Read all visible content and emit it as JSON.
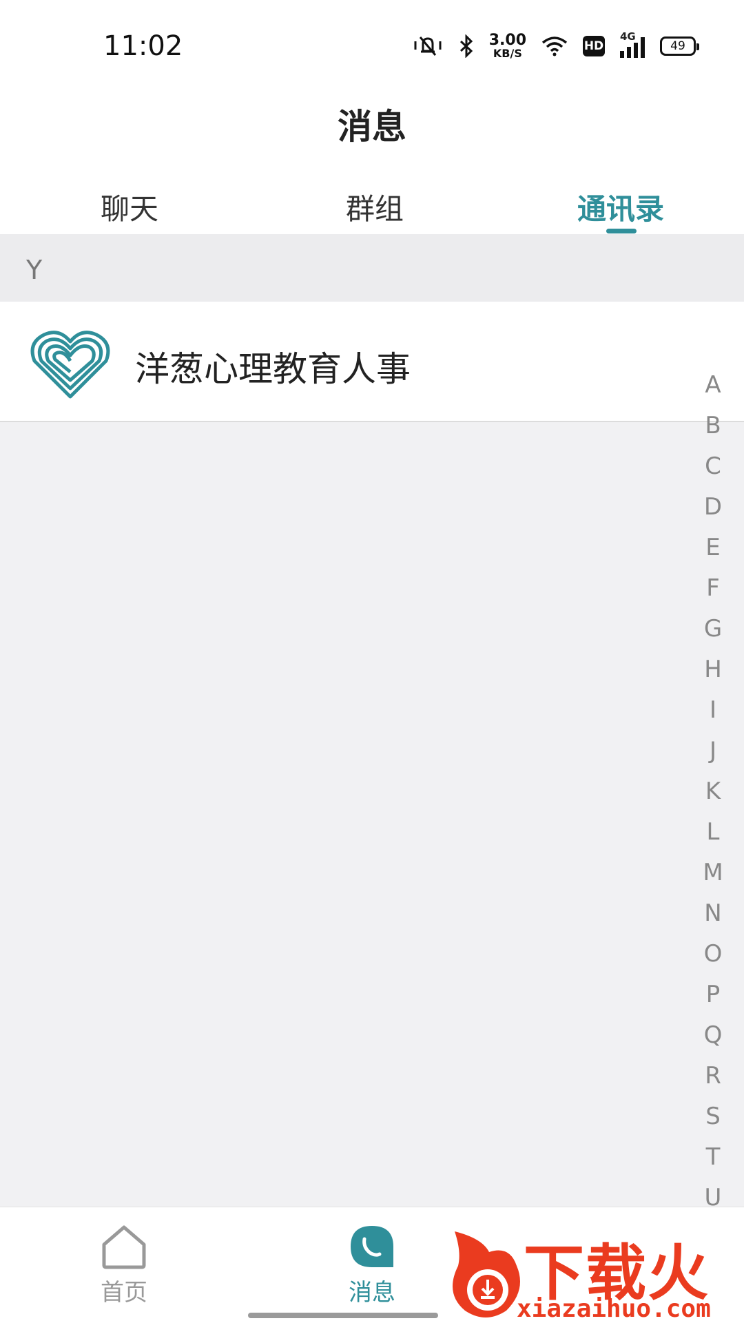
{
  "status_bar": {
    "time": "11:02",
    "net_speed": "3.00",
    "net_unit": "KB/S",
    "hd": "HD",
    "network": "4G",
    "battery": "49"
  },
  "header": {
    "title": "消息"
  },
  "tabs": [
    {
      "label": "聊天",
      "active": false
    },
    {
      "label": "群组",
      "active": false
    },
    {
      "label": "通讯录",
      "active": true
    }
  ],
  "contacts": {
    "section_letter": "Y",
    "items": [
      {
        "name": "洋葱心理教育人事",
        "avatar": "heart-logo-icon"
      }
    ]
  },
  "alphabet_index": [
    "A",
    "B",
    "C",
    "D",
    "E",
    "F",
    "G",
    "H",
    "I",
    "J",
    "K",
    "L",
    "M",
    "N",
    "O",
    "P",
    "Q",
    "R",
    "S",
    "T",
    "U"
  ],
  "bottom_nav": [
    {
      "label": "首页",
      "icon": "home-icon",
      "active": false
    },
    {
      "label": "消息",
      "icon": "chat-bubble-icon",
      "active": true
    }
  ],
  "watermark": {
    "text": "下载火",
    "url": "xiazaihuo.com"
  },
  "colors": {
    "accent": "#2f8f9a",
    "watermark": "#ea3b1f"
  }
}
